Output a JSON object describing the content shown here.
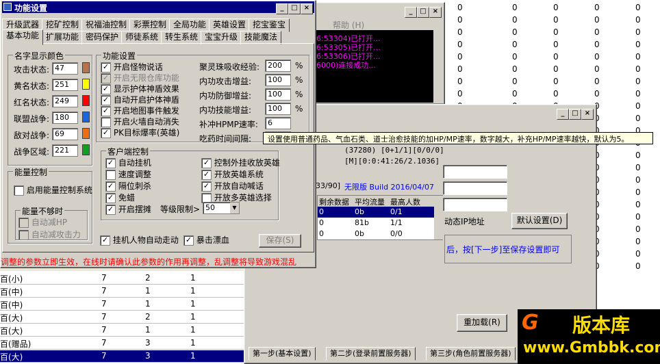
{
  "background_grid": {
    "col_vals": [
      "0",
      "0",
      "0",
      "0",
      "0",
      "0",
      "0",
      "0",
      "0",
      "0",
      "0",
      "0",
      "0",
      "0",
      "0",
      "0",
      "0",
      "0",
      "0",
      "0",
      "0",
      "0"
    ],
    "rows": [
      {
        "name": "百(小)",
        "a": "7",
        "b": "2",
        "c": "1"
      },
      {
        "name": "百(中)",
        "a": "7",
        "b": "1",
        "c": "1"
      },
      {
        "name": "百(中)",
        "a": "7",
        "b": "1",
        "c": "1"
      },
      {
        "name": "百(大)",
        "a": "7",
        "b": "2",
        "c": "1"
      },
      {
        "name": "百(大)",
        "a": "7",
        "b": "1",
        "c": "1"
      },
      {
        "name": "百(赠品)",
        "a": "7",
        "b": "3",
        "c": "1"
      },
      {
        "name": "百(大)",
        "a": "7",
        "b": "3",
        "c": "1"
      }
    ]
  },
  "console_window": {
    "menu_help": "帮助 (H)",
    "lines": [
      "6:53304)已打开...",
      "6:53305)已打开...",
      "6:53306)已打开...",
      "6000)连接成功..."
    ]
  },
  "right_window": {
    "fields": [
      "(37280) [0+1/1][0/0/0]",
      "[M][0:0:41:26/2.1036]"
    ],
    "version_text": "33/90]",
    "version_info": "无限版 Build 2016/04/07",
    "table_headers": [
      "剩余数据",
      "平均流量",
      "最高人数"
    ],
    "table_rows": [
      [
        "0",
        "0b",
        "0/1"
      ],
      [
        "0",
        "81b",
        "1/1"
      ],
      [
        "0",
        "0b",
        "0/0"
      ]
    ],
    "dynamic_ip_label": "动态IP地址",
    "default_btn": "默认设置(D)",
    "hint_text": "后，按[下一步]至保存设置即可",
    "reload_btn": "重加载(R)",
    "wizard_tabs": [
      "第一步(基本设置)",
      "第二步(登录前置服务器)",
      "第三步(角色前置服务器)"
    ]
  },
  "dialog": {
    "title": "功能设置",
    "tabs_row1": [
      "升级武器",
      "挖矿控制",
      "祝福油控制",
      "彩票控制",
      "全局功能",
      "英雄设置",
      "挖宝鉴宝"
    ],
    "tabs_row2": [
      "基本功能",
      "扩展功能",
      "密码保护",
      "师徒系统",
      "转生系统",
      "宝宝升级",
      "技能魔法"
    ],
    "name_color_group": "名字显示颜色",
    "name_colors": [
      {
        "label": "攻击状态:",
        "value": "47",
        "color": "#b8734a"
      },
      {
        "label": "黄名状态:",
        "value": "251",
        "color": "#ffff00"
      },
      {
        "label": "红名状态:",
        "value": "249",
        "color": "#ff0000"
      },
      {
        "label": "联盟战争:",
        "value": "180",
        "color": "#1a64e0"
      },
      {
        "label": "敌对战争:",
        "value": "69",
        "color": "#f06c10"
      },
      {
        "label": "战争区域:",
        "value": "221",
        "color": "#10a020"
      }
    ],
    "energy_group": "能量控制",
    "energy_enable": "启用能量控制系统",
    "energy_low_group": "能量不够时",
    "energy_low_opts": [
      "自动减HP",
      "自动减攻击力"
    ],
    "func_group": "功能设置",
    "func_checks": [
      {
        "label": "开启怪物说话",
        "checked": true,
        "disabled": false
      },
      {
        "label": "开启无限仓库功能",
        "checked": true,
        "disabled": true
      },
      {
        "label": "显示护体神盾效果",
        "checked": true,
        "disabled": false
      },
      {
        "label": "自动开启护体神盾",
        "checked": true,
        "disabled": false
      },
      {
        "label": "开启地图事件触发",
        "checked": true,
        "disabled": false
      },
      {
        "label": "开启火墙自动消失",
        "checked": false,
        "disabled": false
      },
      {
        "label": "PK目标爆率(英雄)",
        "checked": true,
        "disabled": false
      }
    ],
    "func_fields": [
      {
        "label": "聚灵珠吸收经验:",
        "value": "200",
        "unit": "%"
      },
      {
        "label": "内功攻击增益:",
        "value": "100",
        "unit": "%"
      },
      {
        "label": "内功防御增益:",
        "value": "100",
        "unit": "%"
      },
      {
        "label": "内功技能增益:",
        "value": "100",
        "unit": "%"
      },
      {
        "label": "补冲HPMP速率:",
        "value": "6",
        "unit": ""
      },
      {
        "label": "吃药时间间隔:",
        "value": "1",
        "unit": ""
      }
    ],
    "tooltip": "设置使用普通药品、气血石类、道士治愈技能的加HP/MP速率，数字越大，补充HP/MP速率越快，默认为5。",
    "client_group": "客户端控制",
    "client_left": [
      {
        "label": "自动挂机",
        "checked": true
      },
      {
        "label": "速度调整",
        "checked": false
      },
      {
        "label": "隔位刺杀",
        "checked": true
      },
      {
        "label": "免蜡",
        "checked": true
      },
      {
        "label": "开启摆摊",
        "checked": true
      }
    ],
    "client_right": [
      {
        "label": "控制外挂收放英雄",
        "checked": true
      },
      {
        "label": "开放英雄系统",
        "checked": true
      },
      {
        "label": "开放自动喊话",
        "checked": true
      },
      {
        "label": "开放多英雄选择",
        "checked": false
      }
    ],
    "level_limit_label": "等级限制>",
    "level_limit_value": "50",
    "bottom_checks": [
      {
        "label": "挂机人物自动走动",
        "checked": true
      },
      {
        "label": "暴击漂血",
        "checked": true
      }
    ],
    "save_btn": "保存(S)",
    "warning": "调整的参数立即生效，在线时请确认此参数的作用再调整，乱调整将导致游戏混乱"
  },
  "watermark": {
    "brand": "版本库",
    "url": "www.Gmbbk.com"
  },
  "colors": {
    "title": "#000080",
    "warning": "#ff0000",
    "purple": "#ff00ff",
    "blue": "#0000ff"
  }
}
